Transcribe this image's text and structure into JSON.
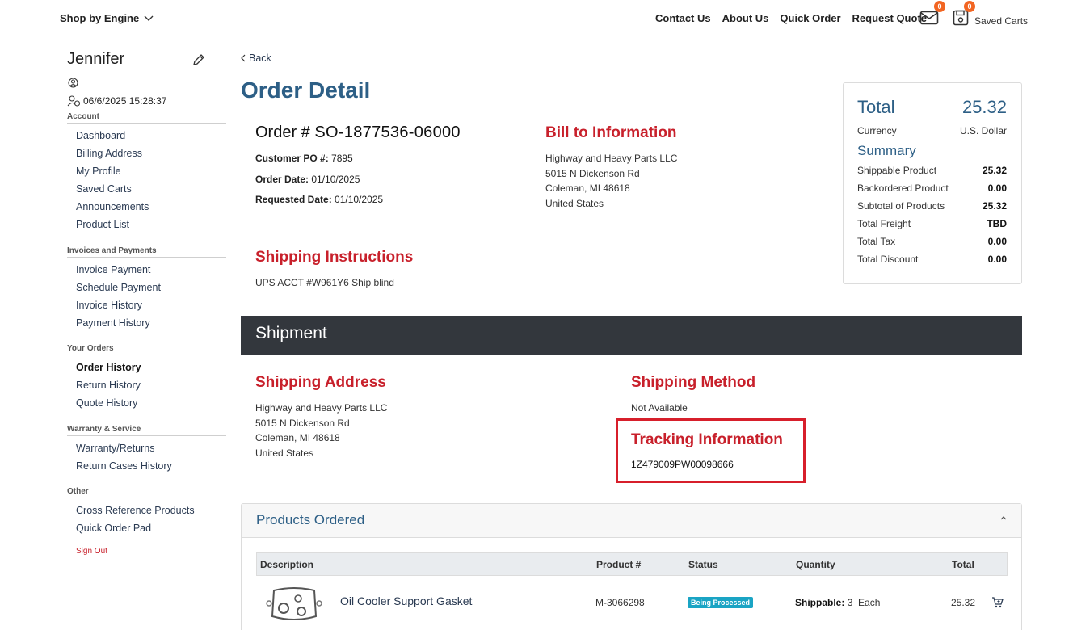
{
  "topnav": {
    "shop_by_engine": "Shop by Engine",
    "links": [
      "Contact Us",
      "About Us",
      "Quick Order",
      "Request Quote"
    ],
    "mail_badge": "0",
    "cart_badge": "0",
    "saved_carts": "Saved Carts"
  },
  "sidebar": {
    "user_name": "Jennifer",
    "last_login": "06/6/2025 15:28:37",
    "sections": [
      {
        "heading": "Account",
        "items": [
          "Dashboard",
          "Billing Address",
          "My Profile",
          "Saved Carts",
          "Announcements",
          "Product List"
        ]
      },
      {
        "heading": "Invoices and Payments",
        "items": [
          "Invoice Payment",
          "Schedule Payment",
          "Invoice History",
          "Payment History"
        ]
      },
      {
        "heading": "Your Orders",
        "items": [
          "Order History",
          "Return History",
          "Quote History"
        ]
      },
      {
        "heading": "Warranty & Service",
        "items": [
          "Warranty/Returns",
          "Return Cases History"
        ]
      },
      {
        "heading": "Other",
        "items": [
          "Cross Reference Products",
          "Quick Order Pad"
        ]
      }
    ],
    "active_item": "Order History",
    "sign_out": "Sign Out"
  },
  "main": {
    "back": "Back",
    "title": "Order Detail",
    "order_prefix": "Order # ",
    "order_number": "SO-1877536-06000",
    "customer_po_label": "Customer PO #:",
    "customer_po": "7895",
    "order_date_label": "Order Date:",
    "order_date": "01/10/2025",
    "requested_date_label": "Requested Date:",
    "requested_date": "01/10/2025",
    "bill_to_heading": "Bill to Information",
    "bill_to": [
      "Highway and Heavy Parts LLC",
      "5015 N Dickenson Rd",
      "Coleman, MI 48618",
      "United States"
    ],
    "shipping_instructions_heading": "Shipping Instructions",
    "shipping_instructions": "UPS ACCT #W961Y6 Ship blind"
  },
  "totals": {
    "total_label": "Total",
    "total_value": "25.32",
    "currency_label": "Currency",
    "currency_value": "U.S. Dollar",
    "summary_label": "Summary",
    "rows": [
      {
        "label": "Shippable Product",
        "value": "25.32"
      },
      {
        "label": "Backordered Product",
        "value": "0.00"
      },
      {
        "label": "Subtotal of Products",
        "value": "25.32"
      },
      {
        "label": "Total Freight",
        "value": "TBD"
      },
      {
        "label": "Total Tax",
        "value": "0.00"
      },
      {
        "label": "Total Discount",
        "value": "0.00"
      }
    ]
  },
  "shipment": {
    "bar_title": "Shipment",
    "address_heading": "Shipping Address",
    "address": [
      "Highway and Heavy Parts LLC",
      "5015 N Dickenson Rd",
      "Coleman, MI 48618",
      "United States"
    ],
    "method_heading": "Shipping Method",
    "method": "Not Available",
    "tracking_heading": "Tracking Information",
    "tracking_number": "1Z479009PW00098666"
  },
  "products": {
    "title": "Products Ordered",
    "columns": [
      "Description",
      "Product #",
      "Status",
      "Quantity",
      "Total"
    ],
    "rows": [
      {
        "description": "Oil Cooler Support Gasket",
        "product_num": "M-3066298",
        "status": "Being Processed",
        "qty_label": "Shippable:",
        "qty": "3",
        "unit": "Each",
        "total": "25.32"
      }
    ]
  },
  "colors": {
    "brand_blue": "#2d5f86",
    "heading_red": "#c8202b",
    "badge_orange": "#f26522",
    "shipment_bar": "#33373d",
    "status_teal": "#1aa4c4",
    "highlight_red": "#d71f2b"
  }
}
